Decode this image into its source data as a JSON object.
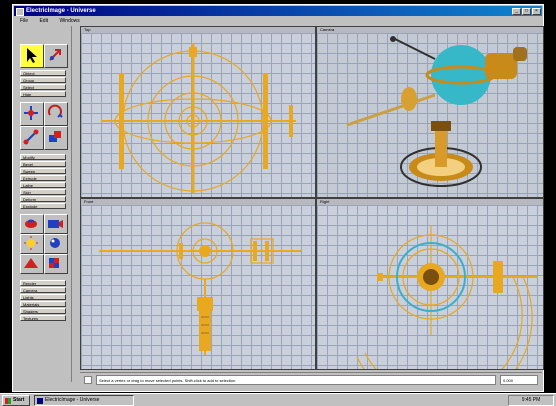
{
  "window": {
    "title": "ElectricImage - Universe"
  },
  "menu": {
    "items": [
      "File",
      "Edit",
      "Windows"
    ]
  },
  "sidebar": {
    "group1": [
      "Object",
      "Group",
      "Select",
      "Hide",
      "Transform",
      "Rotate",
      "Link",
      "Merge"
    ],
    "group2": [
      "Modify",
      "Bevel",
      "Sweep",
      "Extrude",
      "Lathe",
      "Skin",
      "Deform",
      "Explode"
    ],
    "group3": [
      "Render",
      "Camera",
      "Lights",
      "Materials",
      "Shaders",
      "Textures"
    ]
  },
  "viewports": {
    "top_left": {
      "label": "Top"
    },
    "top_right": {
      "label": "Camera"
    },
    "bottom_left": {
      "label": "Front"
    },
    "bottom_right": {
      "label": "Right"
    }
  },
  "statusbar": {
    "text": "Select a vertex or drag to move selected points. Shift-click to add to selection",
    "field": "0.000"
  },
  "taskbar": {
    "start_label": "Start",
    "task_label": "ElectricImage - Universe",
    "clock": "9:45 PM"
  },
  "colors": {
    "title_start": "#000080",
    "title_end": "#1084d0",
    "wire": "#e8a820",
    "accent": "#3ab0c8",
    "grid": "#c9cfdb"
  }
}
